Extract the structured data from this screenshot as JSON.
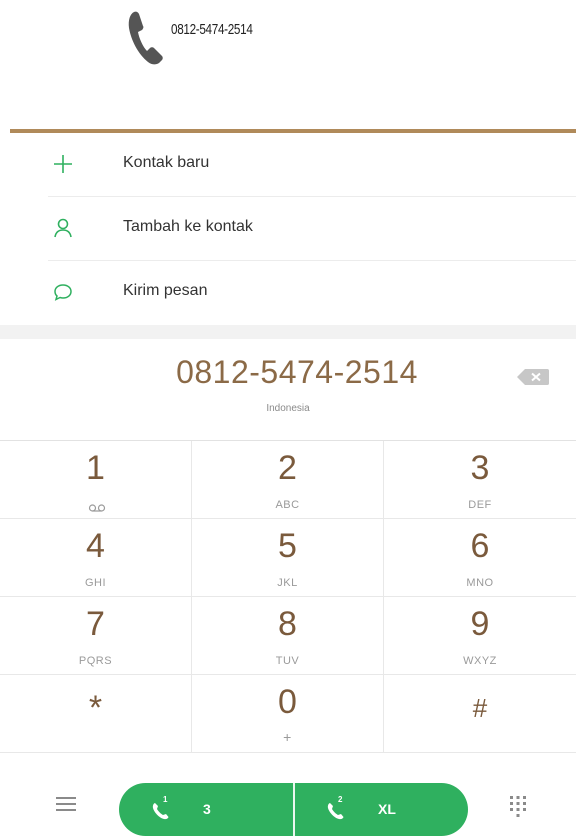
{
  "banner": {
    "phone_number": "0812-5474-2514"
  },
  "menu": {
    "items": [
      {
        "label": "Kontak baru",
        "icon": "plus-icon"
      },
      {
        "label": "Tambah ke kontak",
        "icon": "person-icon"
      },
      {
        "label": "Kirim pesan",
        "icon": "message-icon"
      }
    ]
  },
  "display": {
    "number": "0812-5474-2514",
    "country": "Indonesia"
  },
  "keypad": {
    "keys": [
      {
        "digit": "1",
        "letters": ""
      },
      {
        "digit": "2",
        "letters": "ABC"
      },
      {
        "digit": "3",
        "letters": "DEF"
      },
      {
        "digit": "4",
        "letters": "GHI"
      },
      {
        "digit": "5",
        "letters": "JKL"
      },
      {
        "digit": "6",
        "letters": "MNO"
      },
      {
        "digit": "7",
        "letters": "PQRS"
      },
      {
        "digit": "8",
        "letters": "TUV"
      },
      {
        "digit": "9",
        "letters": "WXYZ"
      },
      {
        "digit": "*",
        "letters": ""
      },
      {
        "digit": "0",
        "letters": "+"
      },
      {
        "digit": "#",
        "letters": ""
      }
    ]
  },
  "call_bar": {
    "sim1": {
      "number": "1",
      "carrier": "3"
    },
    "sim2": {
      "number": "2",
      "carrier": "XL"
    }
  },
  "colors": {
    "accent_green": "#2fb05f",
    "gold": "#b08a5a",
    "digit_brown": "#7a5a3c"
  }
}
